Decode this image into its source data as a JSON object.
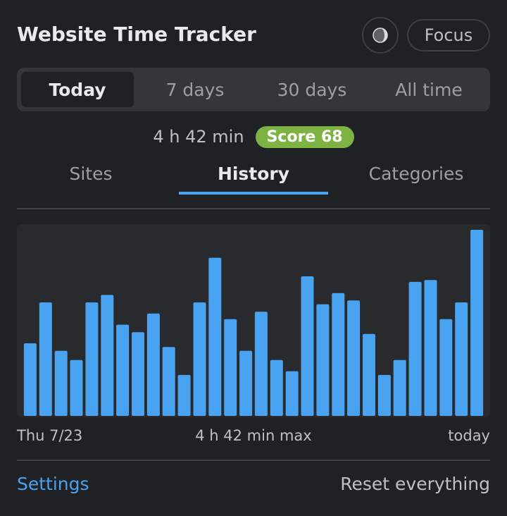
{
  "header": {
    "title": "Website Time Tracker",
    "theme_icon": "half-moon-icon",
    "focus_label": "Focus"
  },
  "range": {
    "options": [
      "Today",
      "7 days",
      "30 days",
      "All time"
    ],
    "selected": "Today"
  },
  "summary": {
    "total": "4 h 42 min",
    "score": "Score 68",
    "score_color": "#7cb342"
  },
  "tabs": {
    "items": [
      "Sites",
      "History",
      "Categories"
    ],
    "active": "History"
  },
  "chart_data": {
    "type": "bar",
    "values": [
      0.39,
      0.61,
      0.35,
      0.3,
      0.61,
      0.65,
      0.49,
      0.45,
      0.55,
      0.37,
      0.22,
      0.61,
      0.85,
      0.52,
      0.35,
      0.56,
      0.3,
      0.24,
      0.75,
      0.6,
      0.66,
      0.62,
      0.44,
      0.22,
      0.3,
      0.72,
      0.73,
      0.52,
      0.61,
      1.0
    ],
    "ylim": [
      0,
      1
    ],
    "bar_color": "#4aa3f0",
    "x_start_label": "Thu 7/23",
    "max_label": "4 h 42 min max",
    "x_end_label": "today"
  },
  "footer": {
    "settings_label": "Settings",
    "reset_label": "Reset everything",
    "accent": "#4aa3f0"
  }
}
